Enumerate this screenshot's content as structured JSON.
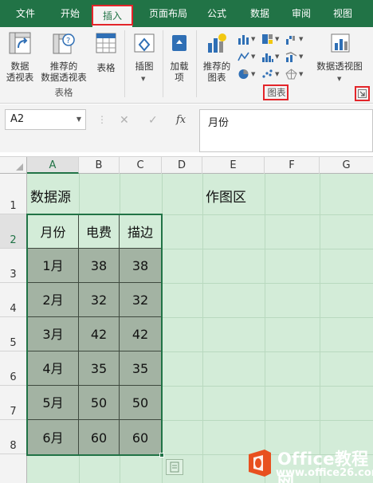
{
  "ribbon_tabs": [
    {
      "label": "文件"
    },
    {
      "label": "开始"
    },
    {
      "label": "插入"
    },
    {
      "label": "页面布局"
    },
    {
      "label": "公式"
    },
    {
      "label": "数据"
    },
    {
      "label": "审阅"
    },
    {
      "label": "视图"
    }
  ],
  "active_tab": "插入",
  "ribbon": {
    "pivot_table": "数据\n透视表",
    "recommended_pivot": "推荐的\n数据透视表",
    "table": "表格",
    "tables_group": "表格",
    "illustrations": "插图",
    "addins": "加载\n项",
    "recommended_charts": "推荐的\n图表",
    "pivot_chart": "数据透视图",
    "charts_group": "图表"
  },
  "formula_bar": {
    "name_box": "A2",
    "formula_value": "月份",
    "fx_label": "fx"
  },
  "columns": [
    "A",
    "B",
    "C",
    "D",
    "E",
    "F",
    "G"
  ],
  "rows": [
    "1",
    "2",
    "3",
    "4",
    "5",
    "6",
    "7",
    "8"
  ],
  "sheet": {
    "a1_label": "数据源",
    "e1_label": "作图区"
  },
  "table": {
    "headers": [
      "月份",
      "电费",
      "描边"
    ],
    "rows": [
      [
        "1月",
        "38",
        "38"
      ],
      [
        "2月",
        "32",
        "32"
      ],
      [
        "3月",
        "42",
        "42"
      ],
      [
        "4月",
        "35",
        "35"
      ],
      [
        "5月",
        "50",
        "50"
      ],
      [
        "6月",
        "60",
        "60"
      ]
    ]
  },
  "watermark": {
    "line1": "Office教程网",
    "line2": "www.office26.com"
  },
  "colors": {
    "excel_green": "#217346",
    "highlight_red": "#e3252a",
    "sheet_fill": "#d3ecd8",
    "data_fill": "#a3b3a3"
  }
}
